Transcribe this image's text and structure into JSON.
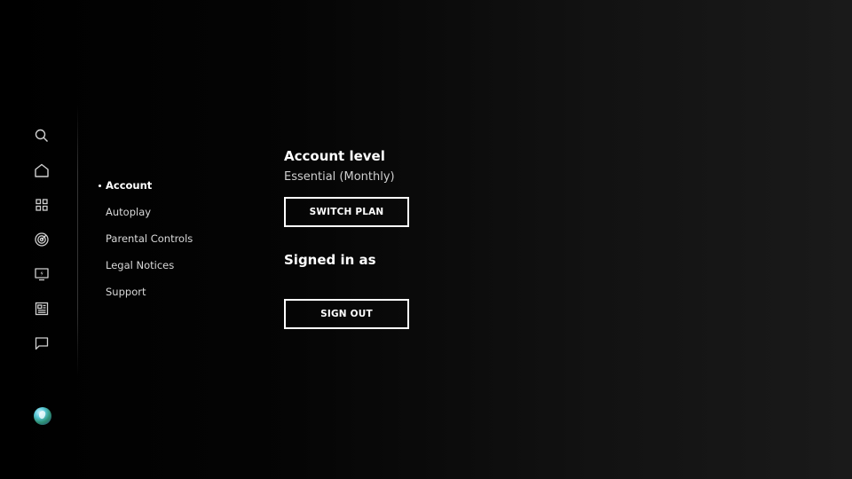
{
  "rail": {
    "icons": [
      "search-icon",
      "home-icon",
      "grid-icon",
      "radar-icon",
      "tv-icon",
      "news-icon",
      "feedback-icon"
    ]
  },
  "menu": {
    "items": [
      {
        "label": "Account",
        "active": true
      },
      {
        "label": "Autoplay",
        "active": false
      },
      {
        "label": "Parental Controls",
        "active": false
      },
      {
        "label": "Legal Notices",
        "active": false
      },
      {
        "label": "Support",
        "active": false
      }
    ]
  },
  "account": {
    "level_title": "Account level",
    "level_value": "Essential (Monthly)",
    "switch_label": "SWITCH PLAN",
    "signed_title": "Signed in as",
    "signed_value": "",
    "signout_label": "SIGN OUT"
  },
  "colors": {
    "background": "#000000",
    "text": "#ffffff",
    "muted_text": "#cfcfcf"
  }
}
